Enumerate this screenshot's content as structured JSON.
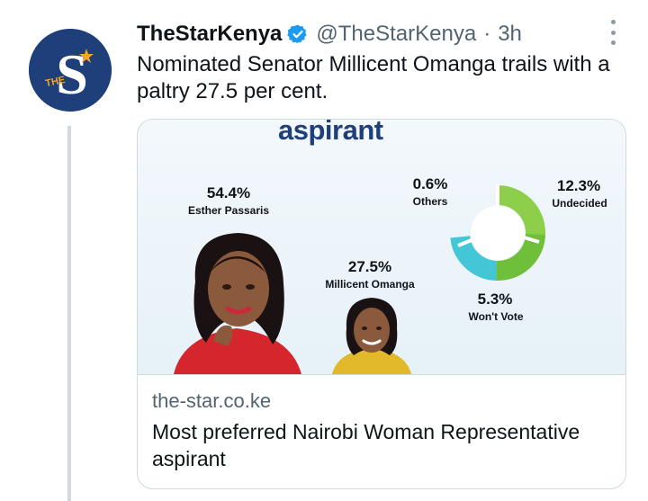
{
  "tweet": {
    "display_name": "TheStarKenya",
    "handle": "@TheStarKenya",
    "separator": "·",
    "time": "3h",
    "text": "Nominated Senator Millicent Omanga trails with a paltry 27.5 per cent.",
    "avatar": {
      "letter": "S",
      "sub": "THE",
      "bg_color": "#1f3f7a",
      "star_color": "#f5a623"
    }
  },
  "card": {
    "domain": "the-star.co.ke",
    "title": "Most preferred Nairobi Woman Representative aspirant",
    "image": {
      "heading": "aspirant",
      "candidates": [
        {
          "pct": "54.4%",
          "name": "Esther Passaris"
        },
        {
          "pct": "27.5%",
          "name": "Millicent Omanga"
        }
      ],
      "donut": [
        {
          "pct": "0.6%",
          "label": "Others"
        },
        {
          "pct": "12.3%",
          "label": "Undecided"
        },
        {
          "pct": "5.3%",
          "label": "Won't Vote"
        }
      ]
    }
  },
  "icons": {
    "verified": "verified-badge-icon",
    "more": "more-options-icon"
  },
  "colors": {
    "verified": "#1d9bf0",
    "text_primary": "#0f1419",
    "text_secondary": "#536471",
    "thread_line": "#cfd9de",
    "donut_green": "#8dcf4a",
    "donut_cyan": "#43c6d6"
  }
}
